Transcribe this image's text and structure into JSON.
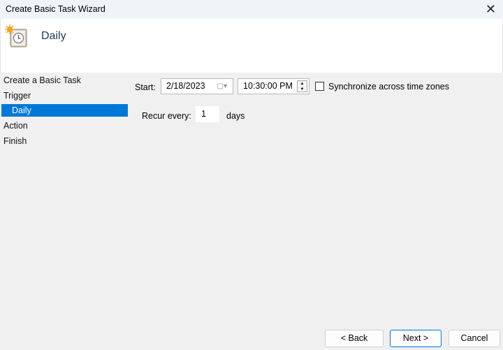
{
  "window": {
    "title": "Create Basic Task Wizard",
    "close_icon": "close-icon"
  },
  "header": {
    "title": "Daily",
    "icon": "scheduled-task-clock-icon"
  },
  "sidebar": {
    "items": [
      {
        "label": "Create a Basic Task"
      },
      {
        "label": "Trigger"
      },
      {
        "label": "Daily",
        "selected": true
      },
      {
        "label": "Action"
      },
      {
        "label": "Finish"
      }
    ]
  },
  "form": {
    "start_label": "Start:",
    "start_date": "2/18/2023",
    "start_time": "10:30:00 PM",
    "sync_label": "Synchronize across time zones",
    "sync_checked": false,
    "recur_label": "Recur every:",
    "recur_value": "1",
    "recur_unit": "days"
  },
  "buttons": {
    "back": "< Back",
    "next": "Next >",
    "cancel": "Cancel"
  },
  "colors": {
    "selection": "#0078d7",
    "background": "#f0f0f0"
  }
}
